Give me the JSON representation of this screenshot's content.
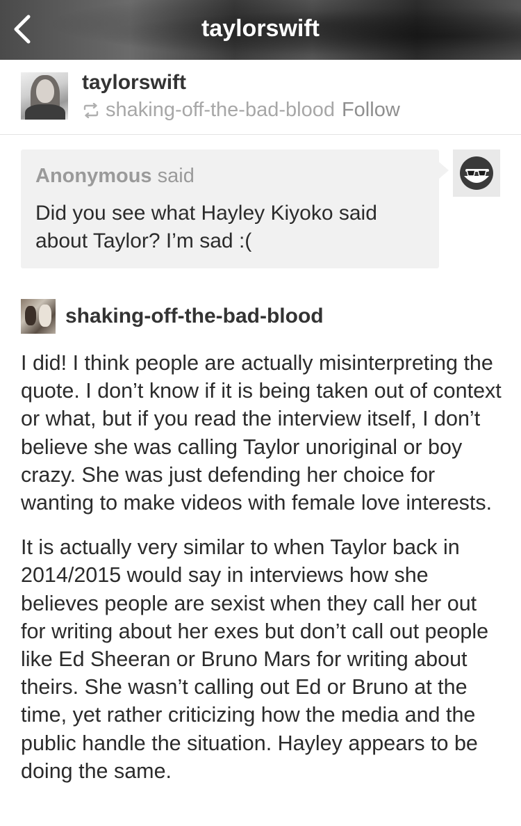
{
  "topbar": {
    "title": "taylorswift",
    "back_icon": "chevron-left-icon"
  },
  "post": {
    "blog_name": "taylorswift",
    "reblog_icon": "reblog-icon",
    "reblogged_from": "shaking-off-the-bad-blood",
    "follow_label": "Follow"
  },
  "ask": {
    "asker": "Anonymous",
    "said": "said",
    "question": "Did you see what Hayley Kiyoko said about Taylor? I’m sad :(",
    "avatar_icon": "sunglasses-face-icon"
  },
  "answer": {
    "blog_name": "shaking-off-the-bad-blood",
    "paragraphs": [
      "I did! I think people are actually misinterpreting the quote. I don’t know if it is being taken out of context or what, but if you read the interview itself, I don’t believe she was calling Taylor unoriginal or boy crazy. She was just defending her choice for wanting to make videos with female love interests.",
      "It is actually very similar to when Taylor back in 2014/2015 would say in interviews how she believes people are sexist when they call her out for writing about her exes but don’t call out people like Ed Sheeran or Bruno Mars for writing about theirs. She wasn’t calling out Ed or Bruno at the time, yet rather criticizing how the media and the public handle the situation. Hayley appears to be doing the same."
    ]
  },
  "colors": {
    "text": "#2b2b2b",
    "muted": "#a7a7a7",
    "ask_bg": "#f1f1f1",
    "divider": "#e4e4e4"
  }
}
